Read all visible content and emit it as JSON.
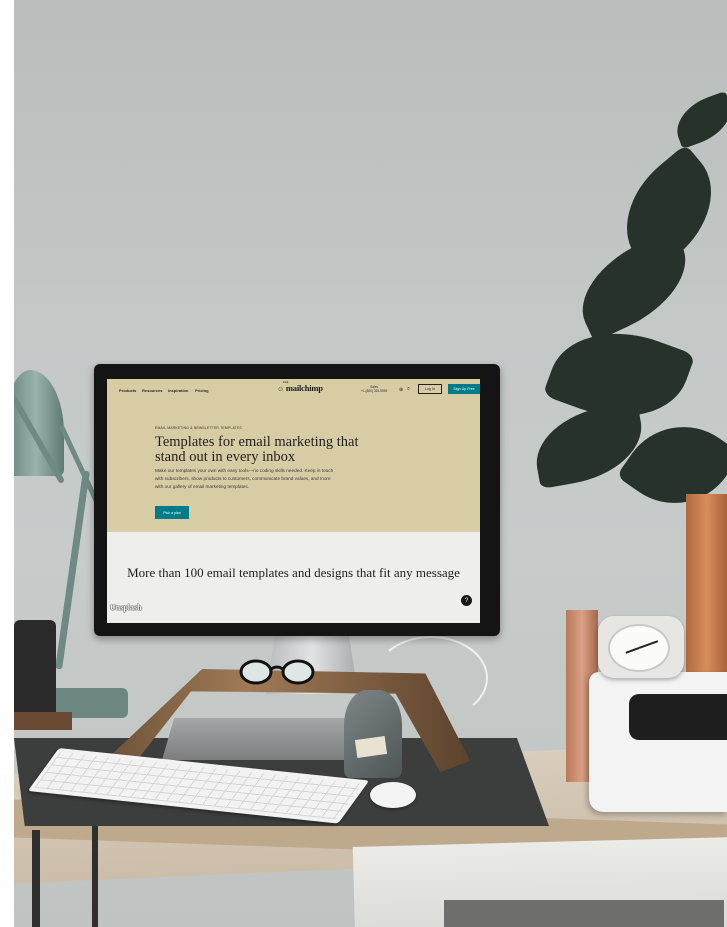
{
  "screen": {
    "nav": {
      "products": "Products",
      "resources": "Resources",
      "inspiration": "Inspiration",
      "pricing": "Pricing",
      "logo_small": "intuit",
      "logo": "mailchimp",
      "sales_label": "Sales",
      "sales_phone": "+1 (800) 315-5939",
      "login": "Log In",
      "signup": "Sign Up Free"
    },
    "hero": {
      "eyebrow": "EMAIL MARKETING & NEWSLETTER TEMPLATES",
      "title": "Templates for email marketing that stand out in every inbox",
      "description": "Make our templates your own with easy tools—no coding skills needed. Keep in touch with subscribers, show products to customers, communicate brand values, and more with our gallery of email marketing templates.",
      "cta": "Pick a plan"
    },
    "section_title": "More than 100 email templates and designs that fit any message",
    "help": "?"
  },
  "watermark": "Unsplash",
  "colors": {
    "wall": "#c4c8c7",
    "screen_bg": "#d8cca5",
    "accent": "#007c89",
    "pot": "#d88d5b",
    "felt": "#3b3e3c"
  }
}
